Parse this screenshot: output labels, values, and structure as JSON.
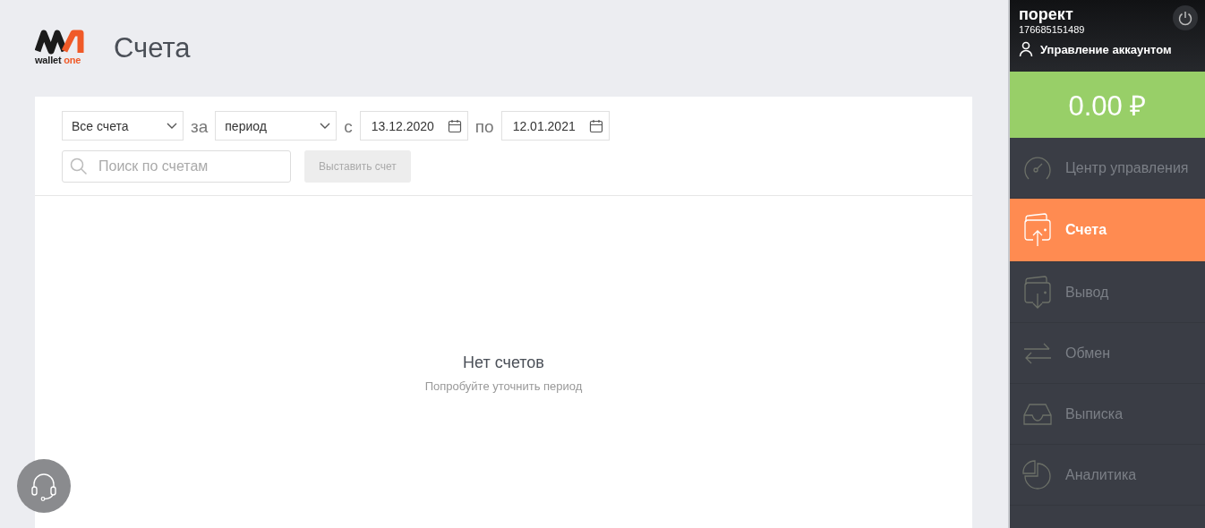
{
  "logo": {
    "word1": "wallet",
    "word2": "one"
  },
  "page_title": "Счета",
  "filters": {
    "account_select": "Все счета",
    "label_for": "за",
    "period_select": "период",
    "label_from": "с",
    "date_from": "13.12.2020",
    "label_to": "по",
    "date_to": "12.01.2021",
    "search": {
      "placeholder": "Поиск по счетам"
    },
    "issue_button": {
      "label": "Выставить счет",
      "disabled": true
    }
  },
  "empty_state": {
    "title": "Нет счетов",
    "hint": "Попробуйте уточнить период"
  },
  "account": {
    "name": "порект",
    "number": "176685151489",
    "manage_link": "Управление аккаунтом"
  },
  "balance": "0.00 ₽",
  "menu": [
    {
      "label": "Центр управления",
      "kind": "gauge",
      "selected": false
    },
    {
      "label": "Счета",
      "kind": "invoice",
      "selected": true
    },
    {
      "label": "Вывод",
      "kind": "withdraw",
      "selected": false
    },
    {
      "label": "Обмен",
      "kind": "exchange",
      "selected": false
    },
    {
      "label": "Выписка",
      "kind": "tray",
      "selected": false
    },
    {
      "label": "Аналитика",
      "kind": "pie",
      "selected": false
    }
  ]
}
